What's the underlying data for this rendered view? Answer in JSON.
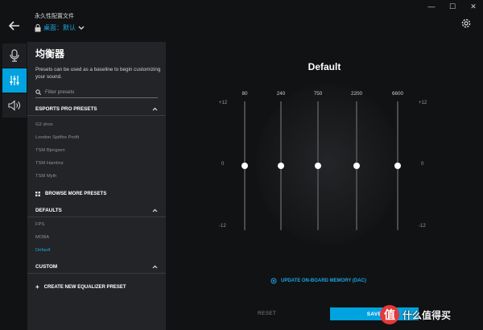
{
  "header": {
    "profile_title": "永久性配置文件",
    "profile_selected": "桌面：默认",
    "window_controls": [
      "—",
      "☐",
      "✕"
    ]
  },
  "rail": {
    "items": [
      {
        "icon": "microphone-icon",
        "active": false
      },
      {
        "icon": "equalizer-icon",
        "active": true
      },
      {
        "icon": "speaker-icon",
        "active": false
      }
    ]
  },
  "panel": {
    "title": "均衡器",
    "description": "Presets can be used as a baseline to begin customizing your sound.",
    "filter_placeholder": "Filter presets",
    "esports": {
      "heading": "ESPORTS PRO PRESETS",
      "items": [
        "G2 shox",
        "London Spitfire Profit",
        "TSM Bjergsen",
        "TSM Hamlinz",
        "TSM Myth"
      ]
    },
    "browse_more": "BROWSE MORE PRESETS",
    "defaults": {
      "heading": "DEFAULTS",
      "items": [
        "FPS",
        "MOBA",
        "Default"
      ],
      "selected": "Default"
    },
    "custom": {
      "heading": "CUSTOM",
      "create": "CREATE NEW EQUALIZER PRESET"
    }
  },
  "eq": {
    "title": "Default",
    "db_max": "+12",
    "db_mid": "0",
    "db_min": "-12",
    "bands": [
      {
        "freq": "80",
        "gain_db": 0
      },
      {
        "freq": "240",
        "gain_db": 0
      },
      {
        "freq": "750",
        "gain_db": 0
      },
      {
        "freq": "2200",
        "gain_db": 0
      },
      {
        "freq": "6600",
        "gain_db": 0
      }
    ],
    "update_memory": "UPDATE ON-BOARD MEMORY (DAC)",
    "reset_label": "RESET",
    "save_label": "SAVE"
  },
  "watermark": {
    "logo_char": "值",
    "text": "什么值得买"
  },
  "colors": {
    "accent": "#00a3e0",
    "background": "#111214",
    "panel": "#232427"
  }
}
